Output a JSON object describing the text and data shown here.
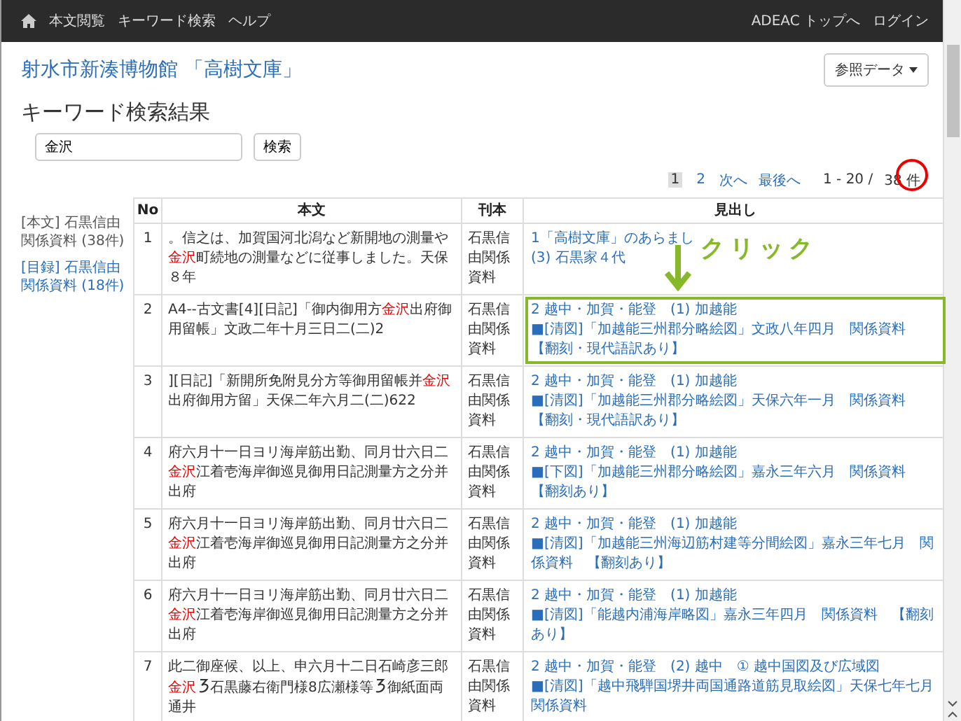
{
  "navbar": {
    "left": [
      "本文閲覧",
      "キーワード検索",
      "ヘルプ"
    ],
    "right": [
      "ADEAC トップへ",
      "ログイン"
    ]
  },
  "site_title": "射水市新湊博物館 「高樹文庫」",
  "reference_button": "参照データ",
  "heading": "キーワード検索結果",
  "search": {
    "value": "金沢",
    "button": "検索"
  },
  "pager": {
    "pages": [
      {
        "label": "1",
        "selected": true
      },
      {
        "label": "2",
        "selected": false
      }
    ],
    "next": "次へ",
    "last": "最後へ",
    "range": "1 - 20 /",
    "total": "38 件"
  },
  "sidebar": {
    "items": [
      {
        "label": "[本文] 石黒信由関係資料 (38件)",
        "selected": true
      },
      {
        "label": "[目録] 石黒信由関係資料 (18件)",
        "selected": false
      }
    ]
  },
  "table": {
    "columns": [
      "No",
      "本文",
      "刊本",
      "見出し"
    ],
    "rows": [
      {
        "no": "1",
        "body": [
          {
            "text": "。信之は、加賀国河北潟など新開地の測量や",
            "highlight": false
          },
          {
            "text": "金沢",
            "highlight": true
          },
          {
            "text": "町続地の測量などに従事しました。天保８年",
            "highlight": false
          }
        ],
        "source": "石黒信由関係資料",
        "headings": [
          "1「高樹文庫」のあらまし",
          "(3) 石黒家４代"
        ],
        "highlighted": false
      },
      {
        "no": "2",
        "body": [
          {
            "text": "A4--古文書[4][日記]「御内御用方",
            "highlight": false
          },
          {
            "text": "金沢",
            "highlight": true
          },
          {
            "text": "出府御用留帳」文政二年十月三日二(二)2",
            "highlight": false
          }
        ],
        "source": "石黒信由関係資料",
        "headings": [
          "2 越中・加賀・能登　(1) 加越能",
          "■[清図]「加越能三州郡分略絵図」文政八年四月　関係資料",
          "【翻刻・現代語訳あり】"
        ],
        "highlighted": true
      },
      {
        "no": "3",
        "body": [
          {
            "text": "][日記]「新開所免附見分方等御用留帳并",
            "highlight": false
          },
          {
            "text": "金沢",
            "highlight": true
          },
          {
            "text": "出府御用方留」天保二年六月二(二)622",
            "highlight": false
          }
        ],
        "source": "石黒信由関係資料",
        "headings": [
          "2 越中・加賀・能登　(1) 加越能",
          "■[清図]「加越能三州郡分略絵図」天保六年一月　関係資料",
          "【翻刻・現代語訳あり】"
        ],
        "highlighted": false
      },
      {
        "no": "4",
        "body": [
          {
            "text": "府六月十一日ヨリ海岸筋出勤、同月廿六日二",
            "highlight": false
          },
          {
            "text": "金沢",
            "highlight": true
          },
          {
            "text": "江着壱海岸御巡見御用日記測量方之分并出府",
            "highlight": false
          }
        ],
        "source": "石黒信由関係資料",
        "headings": [
          "2 越中・加賀・能登　(1) 加越能",
          "■[下図]「加越能三州郡分略絵図」嘉永三年六月　関係資料",
          "【翻刻あり】"
        ],
        "highlighted": false
      },
      {
        "no": "5",
        "body": [
          {
            "text": "府六月十一日ヨリ海岸筋出勤、同月廿六日二",
            "highlight": false
          },
          {
            "text": "金沢",
            "highlight": true
          },
          {
            "text": "江着壱海岸御巡見御用日記測量方之分并出府",
            "highlight": false
          }
        ],
        "source": "石黒信由関係資料",
        "headings": [
          "2 越中・加賀・能登　(1) 加越能",
          "■[清図]「加越能三州海辺筋村建等分間絵図」嘉永三年七月　関係資料　【翻刻あり】"
        ],
        "highlighted": false
      },
      {
        "no": "6",
        "body": [
          {
            "text": "府六月十一日ヨリ海岸筋出勤、同月廿六日二",
            "highlight": false
          },
          {
            "text": "金沢",
            "highlight": true
          },
          {
            "text": "江着壱海岸御巡見御用日記測量方之分并出府",
            "highlight": false
          }
        ],
        "source": "石黒信由関係資料",
        "headings": [
          "2 越中・加賀・能登　(1) 加越能",
          "■[清図]「能越内浦海岸略図」嘉永三年四月　関係資料　【翻刻あり】"
        ],
        "highlighted": false
      },
      {
        "no": "7",
        "body": [
          {
            "text": "此二御座候、以上、申六月十二日石崎彦三郎",
            "highlight": false
          },
          {
            "text": "金沢",
            "highlight": true
          },
          {
            "kind": "glyph",
            "highlight": false
          },
          {
            "text": "石黒藤右衛門様8広瀬様等",
            "highlight": false
          },
          {
            "kind": "glyph",
            "highlight": false
          },
          {
            "text": "御紙面両通井",
            "highlight": false
          }
        ],
        "source": "石黒信由関係資料",
        "headings": [
          "2 越中・加賀・能登　(2) 越中　① 越中国図及び広域図",
          "■[清図]「越中飛騨国堺井両国通路道筋見取絵図」天保七年七月関係資料"
        ],
        "highlighted": false
      }
    ]
  },
  "annotation": {
    "label": "クリック"
  }
}
